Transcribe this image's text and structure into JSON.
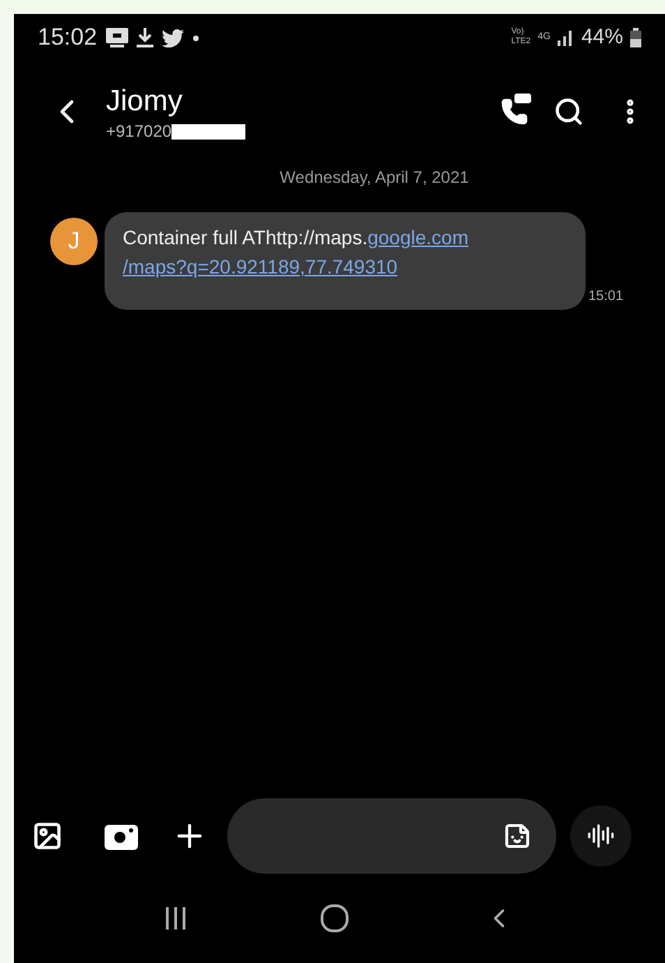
{
  "status_bar": {
    "time": "15:02",
    "volte": [
      "Vo)",
      "LTE2"
    ],
    "network": "4G",
    "battery": "44%"
  },
  "header": {
    "contact_name": "Jiomy",
    "phone_number": "+917020"
  },
  "date_divider": "Wednesday, April 7, 2021",
  "messages": [
    {
      "avatar_letter": "J",
      "time": "15:01",
      "segments": [
        {
          "kind": "text",
          "text": "Container full  AThttp://maps."
        },
        {
          "kind": "link",
          "text": "google.com"
        },
        {
          "kind": "break"
        },
        {
          "kind": "link",
          "text": "/maps?q=20.921189,77.749310"
        }
      ]
    }
  ]
}
